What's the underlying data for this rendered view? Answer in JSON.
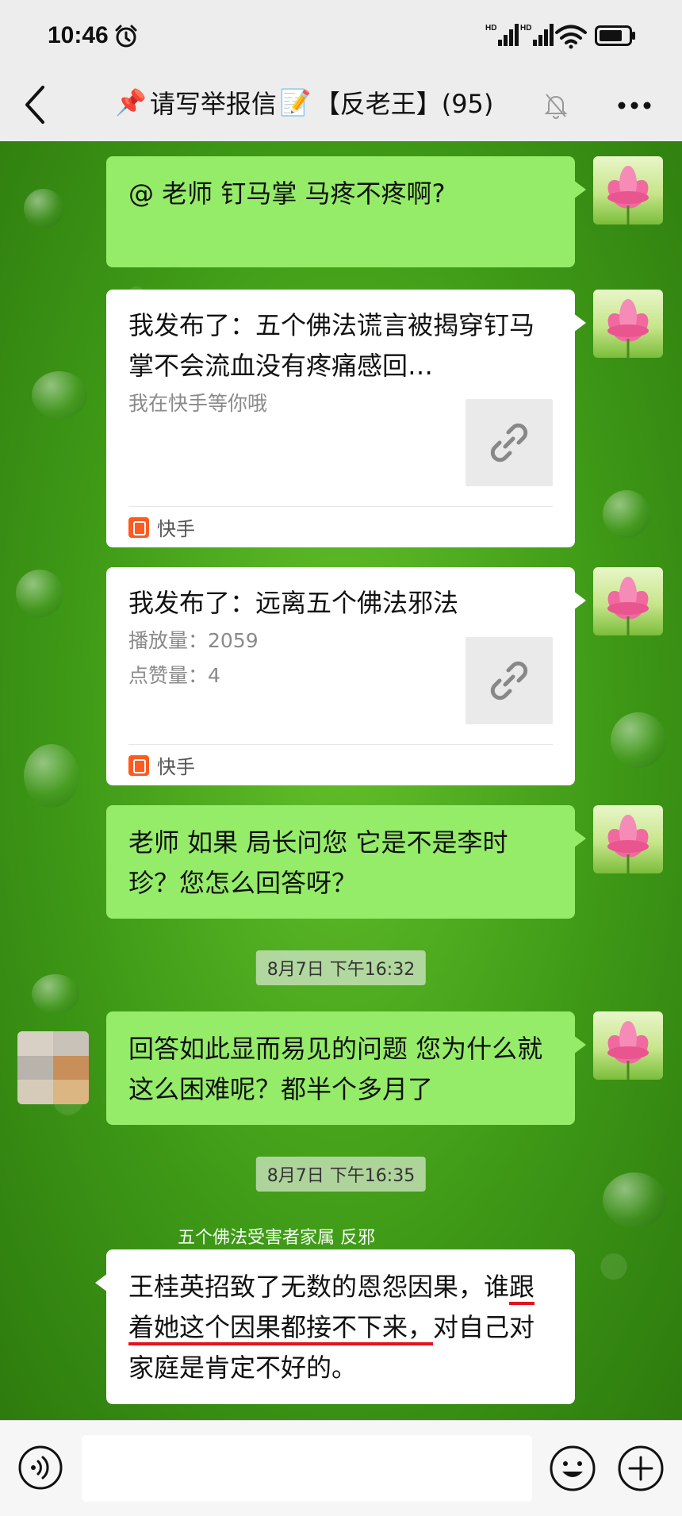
{
  "status_bar": {
    "time": "10:46"
  },
  "header": {
    "title_pin": "📌",
    "title_text": "请写举报信",
    "title_memo": "📝",
    "title_group": "【反老王】(95)"
  },
  "messages": [
    {
      "type": "text",
      "text": "@          老师 钉马掌 马疼不疼啊?"
    },
    {
      "type": "link_card",
      "title": "我发布了：五个佛法谎言被揭穿钉马掌不会流血没有疼痛感回…",
      "meta": [
        "我在快手等你哦"
      ],
      "source": "快手"
    },
    {
      "type": "link_card",
      "title": "我发布了：远离五个佛法邪法",
      "meta": [
        "播放量：2059",
        "点赞量：4"
      ],
      "source": "快手"
    },
    {
      "type": "text",
      "text": "老师 如果  局长问您 它是不是李时珍？您怎么回答呀？"
    },
    {
      "type": "time",
      "text": "8月7日 下午16:32"
    },
    {
      "type": "text",
      "text": "回答如此显而易见的问题 您为什么就这么困难呢？都半个多月了"
    },
    {
      "type": "time",
      "text": "8月7日 下午16:35"
    }
  ],
  "incoming": {
    "sender": "五个佛法受害者家属 反邪",
    "text_part1": "王桂英招致了无数的恩怨因果，谁",
    "text_underlined": "跟着她这个因果都接不下来，",
    "text_part2": "对自己对家庭是肯定不好的。"
  },
  "colors": {
    "bubble_green": "#95ec69",
    "underline_red": "#e3131c",
    "kuaishou_orange": "#ff5a1f"
  },
  "icons": [
    "alarm-icon",
    "signal-icon",
    "wifi-icon",
    "battery-icon",
    "back-icon",
    "mute-icon",
    "more-icon",
    "link-icon",
    "kuaishou-logo",
    "voice-icon",
    "emoji-icon",
    "plus-icon"
  ]
}
